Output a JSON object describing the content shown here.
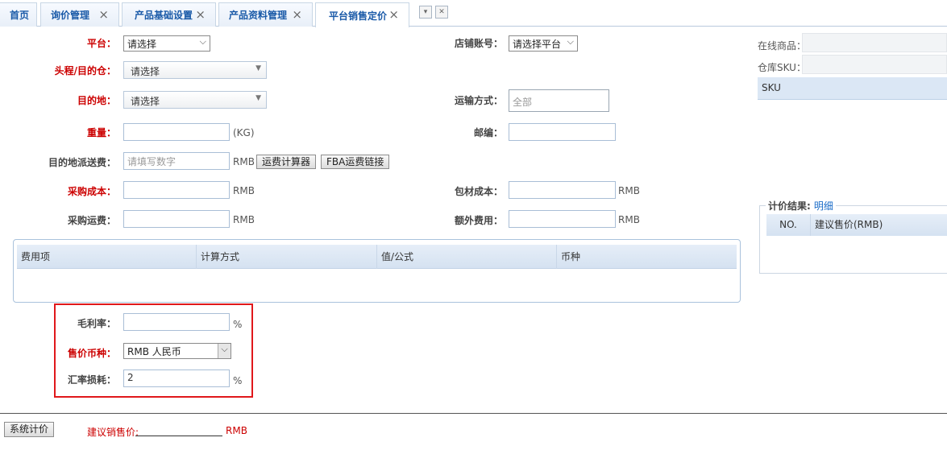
{
  "tabs": [
    {
      "label": "首页",
      "closable": false
    },
    {
      "label": "询价管理",
      "closable": true
    },
    {
      "label": "产品基础设置",
      "closable": true
    },
    {
      "label": "产品资料管理",
      "closable": true
    },
    {
      "label": "平台销售定价",
      "closable": true,
      "active": true
    }
  ],
  "tab_tools": {
    "menu": "▾",
    "close": "✕"
  },
  "form": {
    "platform": {
      "label": "平台：",
      "value": "请选择"
    },
    "shop_account": {
      "label": "店铺账号：",
      "value": "请选择平台"
    },
    "head_warehouse": {
      "label": "头程/目的仓：",
      "value": "请选择"
    },
    "destination": {
      "label": "目的地：",
      "value": "请选择"
    },
    "shipping_method": {
      "label": "运输方式：",
      "value": "全部"
    },
    "weight": {
      "label": "重量：",
      "value": "",
      "unit": "(KG)"
    },
    "postcode": {
      "label": "邮编：",
      "value": ""
    },
    "dest_delivery_fee": {
      "label": "目的地派送费：",
      "placeholder": "请填写数字",
      "unit": "RMB"
    },
    "calc_button": "运费计算器",
    "fba_button": "FBA运费链接",
    "purchase_cost": {
      "label": "采购成本：",
      "value": "",
      "unit": "RMB"
    },
    "packaging_cost": {
      "label": "包材成本：",
      "value": "",
      "unit": "RMB"
    },
    "purchase_freight": {
      "label": "采购运费：",
      "value": "",
      "unit": "RMB"
    },
    "extra_fee": {
      "label": "额外费用：",
      "value": "",
      "unit": "RMB"
    }
  },
  "fee_table": {
    "columns": [
      "费用项",
      "计算方式",
      "值/公式",
      "币种"
    ]
  },
  "margin": {
    "gross_margin": {
      "label": "毛利率：",
      "value": "",
      "unit": "%"
    },
    "currency": {
      "label": "售价币种：",
      "value": "RMB 人民币"
    },
    "fx_loss": {
      "label": "汇率损耗：",
      "value": "2",
      "unit": "%"
    }
  },
  "right": {
    "online_product_label": "在线商品：",
    "warehouse_sku_label": "仓库SKU：",
    "sku_header": "SKU",
    "calc_result_label": "计价结果:",
    "calc_result_link": "明细",
    "calc_columns": [
      "NO.",
      "建议售价(RMB)"
    ]
  },
  "footer": {
    "calc_button": "系统计价",
    "suggested_label": "建议销售价:",
    "unit": "RMB"
  },
  "colors": {
    "required": "#cc0000",
    "tab_text": "#1a5aa8",
    "highlight_box": "#e0181b"
  }
}
